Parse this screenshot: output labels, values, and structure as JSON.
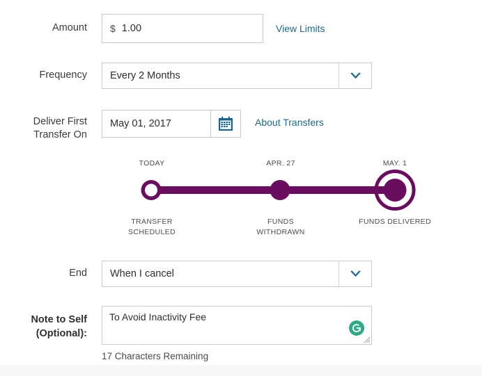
{
  "form": {
    "amount": {
      "label": "Amount",
      "currency_symbol": "$",
      "value": "1.00",
      "link_label": "View Limits",
      "link_color": "#1b6a8a"
    },
    "frequency": {
      "label": "Frequency",
      "value": "Every 2 Months",
      "arrow_icon": "chevron-down-icon",
      "arrow_color": "#1a6a96"
    },
    "deliver_first_transfer": {
      "label_line1": "Deliver First",
      "label_line2": "Transfer On",
      "value": "May 01, 2017",
      "calendar_icon": "calendar-icon",
      "calendar_icon_color": "#176396",
      "link_label": "About Transfers"
    },
    "end": {
      "label": "End",
      "value": "When I cancel",
      "arrow_icon": "chevron-down-icon"
    },
    "note_to_self": {
      "label_line1": "Note to Self",
      "label_line2": "(Optional):",
      "value": "To Avoid Inactivity Fee",
      "placeholder": "",
      "characters_remaining": "17 Characters Remaining",
      "assistant_icon": "grammarly-icon",
      "assistant_icon_color": "#2eaa84",
      "resize_handle": "resize-grip-icon"
    }
  },
  "timeline": {
    "accent_color": "#6b0d5f",
    "steps": [
      {
        "date": "TODAY",
        "caption_line1": "TRANSFER",
        "caption_line2": "SCHEDULED",
        "marker": "hollow-circle"
      },
      {
        "date": "APR. 27",
        "caption_line1": "FUNDS",
        "caption_line2": "WITHDRAWN",
        "marker": "filled-circle"
      },
      {
        "date": "MAY. 1",
        "caption_line1": "FUNDS DELIVERED",
        "caption_line2": "",
        "marker": "filled-circle-ring"
      }
    ]
  }
}
